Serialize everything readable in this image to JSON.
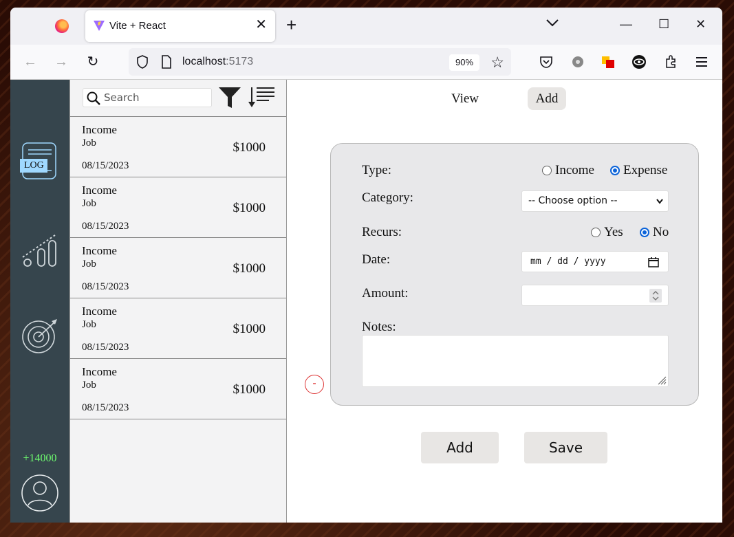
{
  "browser": {
    "tab_title": "Vite + React",
    "url_host": "localhost",
    "url_port": ":5173",
    "zoom": "90%"
  },
  "sidebar": {
    "log_label": "LOG",
    "balance": "+14000"
  },
  "list": {
    "search_placeholder": "Search",
    "entries": [
      {
        "type": "Income",
        "category": "Job",
        "amount": "$1000",
        "date": "08/15/2023"
      },
      {
        "type": "Income",
        "category": "Job",
        "amount": "$1000",
        "date": "08/15/2023"
      },
      {
        "type": "Income",
        "category": "Job",
        "amount": "$1000",
        "date": "08/15/2023"
      },
      {
        "type": "Income",
        "category": "Job",
        "amount": "$1000",
        "date": "08/15/2023"
      },
      {
        "type": "Income",
        "category": "Job",
        "amount": "$1000",
        "date": "08/15/2023"
      }
    ]
  },
  "main": {
    "tabs": [
      {
        "label": "View"
      },
      {
        "label": "Add"
      }
    ],
    "active_tab": "Add",
    "form": {
      "type_label": "Type:",
      "type_options": [
        "Income",
        "Expense"
      ],
      "type_selected": "Expense",
      "category_label": "Category:",
      "category_selected": "-- Choose option --",
      "recurs_label": "Recurs:",
      "recurs_options": [
        "Yes",
        "No"
      ],
      "recurs_selected": "No",
      "date_label": "Date:",
      "date_placeholder": "mm / dd / yyyy",
      "amount_label": "Amount:",
      "amount_value": "",
      "notes_label": "Notes:",
      "notes_value": "",
      "remove_label": "-"
    },
    "buttons": {
      "add": "Add",
      "save": "Save"
    }
  },
  "colors": {
    "rail": "#36454d",
    "balance": "#6fff6f",
    "radio_on": "#0b63d9",
    "remove": "#dd3333"
  }
}
